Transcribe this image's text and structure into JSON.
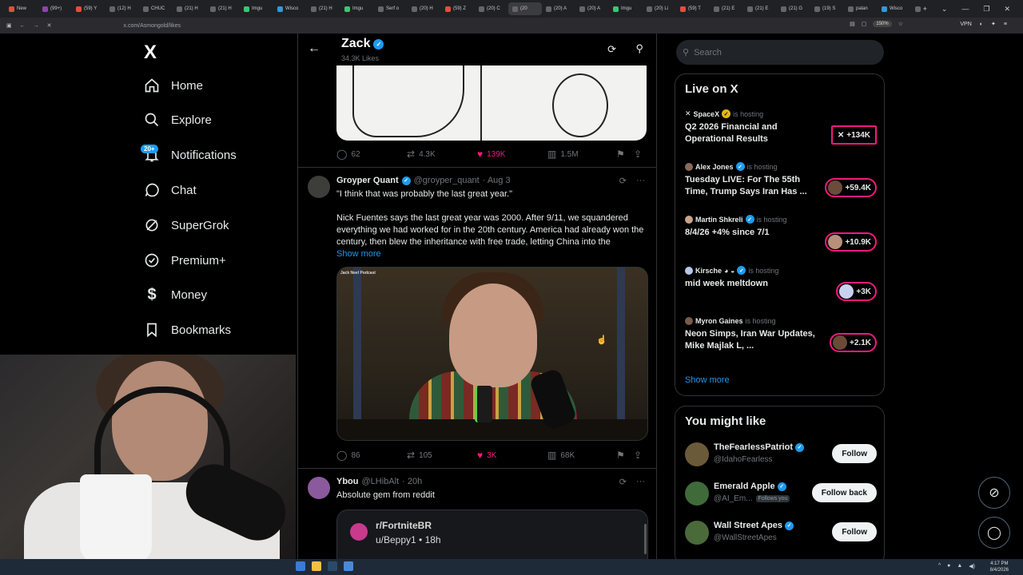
{
  "browser": {
    "tabs": [
      {
        "label": "New",
        "color": "#e74c3c"
      },
      {
        "label": "(99+)",
        "color": "#8e44ad"
      },
      {
        "label": "(59) Y",
        "color": "#e74c3c"
      },
      {
        "label": "(12) H",
        "color": "#666666"
      },
      {
        "label": "CHUC",
        "color": "#666666"
      },
      {
        "label": "(21) H",
        "color": "#666666"
      },
      {
        "label": "(21) H",
        "color": "#666666"
      },
      {
        "label": "Imgu",
        "color": "#2ecc71"
      },
      {
        "label": "Wisco",
        "color": "#3498db"
      },
      {
        "label": "(21) H",
        "color": "#666666"
      },
      {
        "label": "Imgu",
        "color": "#2ecc71"
      },
      {
        "label": "Serf o",
        "color": "#666666"
      },
      {
        "label": "(20) H",
        "color": "#666666"
      },
      {
        "label": "(59) Z",
        "color": "#e74c3c"
      },
      {
        "label": "(20) C",
        "color": "#666666"
      },
      {
        "label": "(20",
        "color": "#666666",
        "active": true
      },
      {
        "label": "(20) A",
        "color": "#666666"
      },
      {
        "label": "(20) A",
        "color": "#666666"
      },
      {
        "label": "Imgu",
        "color": "#2ecc71"
      },
      {
        "label": "(20) Li",
        "color": "#666666"
      },
      {
        "label": "(59) T",
        "color": "#e74c3c"
      },
      {
        "label": "(21) E",
        "color": "#666666"
      },
      {
        "label": "(21) E",
        "color": "#666666"
      },
      {
        "label": "(21) G",
        "color": "#666666"
      },
      {
        "label": "(19) S",
        "color": "#666666"
      },
      {
        "label": "palan",
        "color": "#666666"
      },
      {
        "label": "Wisco",
        "color": "#3498db"
      },
      {
        "label": "(21) E",
        "color": "#666666"
      },
      {
        "label": "X",
        "color": "#666666"
      }
    ],
    "url": "x.com/Asmongold/likes",
    "zoom": "150%",
    "vpn": "VPN"
  },
  "nav": {
    "logo": "X",
    "items": [
      {
        "label": "Home",
        "icon": "home-icon"
      },
      {
        "label": "Explore",
        "icon": "search-icon"
      },
      {
        "label": "Notifications",
        "icon": "bell-icon",
        "badge": "20+"
      },
      {
        "label": "Chat",
        "icon": "chat-icon"
      },
      {
        "label": "SuperGrok",
        "icon": "grok-icon"
      },
      {
        "label": "Premium+",
        "icon": "verified-badge-icon"
      },
      {
        "label": "Money",
        "icon": "dollar-icon"
      },
      {
        "label": "Bookmarks",
        "icon": "bookmark-icon"
      }
    ]
  },
  "header": {
    "title": "Zack",
    "subtitle": "34.3K Likes"
  },
  "tweet1": {
    "stats": {
      "replies": "62",
      "reposts": "4.3K",
      "likes": "139K",
      "views": "1.5M"
    }
  },
  "tweet2": {
    "name": "Groyper Quant",
    "handle": "@groyper_quant",
    "date": "· Aug 3",
    "text_line1": "\"I think that was probably the last great year.\"",
    "text_body": "Nick Fuentes says the last great year was 2000. After 9/11, we squandered everything we had worked for in the 20th century. America had already won the century, then blew the inheritance with free trade, letting China into the",
    "show_more": "Show more",
    "video_label": "Jack Neel Podcast",
    "stats": {
      "replies": "86",
      "reposts": "105",
      "likes": "3K",
      "views": "68K"
    }
  },
  "tweet3": {
    "name": "Ybou",
    "handle": "@LHibAlt",
    "date": "· 20h",
    "text": "Absolute gem from reddit",
    "embed_sub": "r/FortniteBR",
    "embed_user": "u/Beppy1 • 18h"
  },
  "search": {
    "placeholder": "Search"
  },
  "live": {
    "title": "Live on X",
    "items": [
      {
        "host": "SpaceX",
        "hosting": "is hosting",
        "title": "Q2 2026 Financial and Operational Results",
        "count": "+134K"
      },
      {
        "host": "Alex Jones",
        "hosting": "is hosting",
        "title": "Tuesday LIVE: For The 55th Time, Trump Says Iran Has ...",
        "count": "+59.4K"
      },
      {
        "host": "Martin Shkreli",
        "hosting": "is hosting",
        "title": "8/4/26 +4% since 7/1",
        "count": "+10.9K"
      },
      {
        "host": "Kirsche",
        "hosting": "is hosting",
        "title": "mid week meltdown",
        "count": "+3K"
      },
      {
        "host": "Myron Gaines",
        "hosting": "is hosting",
        "title": "Neon Simps, Iran War Updates, Mike Majlak L, ...",
        "count": "+2.1K"
      }
    ],
    "show_more": "Show more"
  },
  "suggest": {
    "title": "You might like",
    "items": [
      {
        "name": "TheFearlessPatriot",
        "handle": "@IdahoFearless",
        "button": "Follow"
      },
      {
        "name": "Emerald Apple",
        "handle": "@AI_Em...",
        "follows_you": "Follows you",
        "button": "Follow back"
      },
      {
        "name": "Wall Street Apes",
        "handle": "@WallStreetApes",
        "button": "Follow"
      }
    ]
  },
  "taskbar": {
    "time": "4:17 PM",
    "date": "8/4/2026"
  },
  "colors": {
    "accent": "#1d9bf0",
    "like": "#f91880",
    "live_border": "#f91880",
    "bg": "#000000"
  }
}
